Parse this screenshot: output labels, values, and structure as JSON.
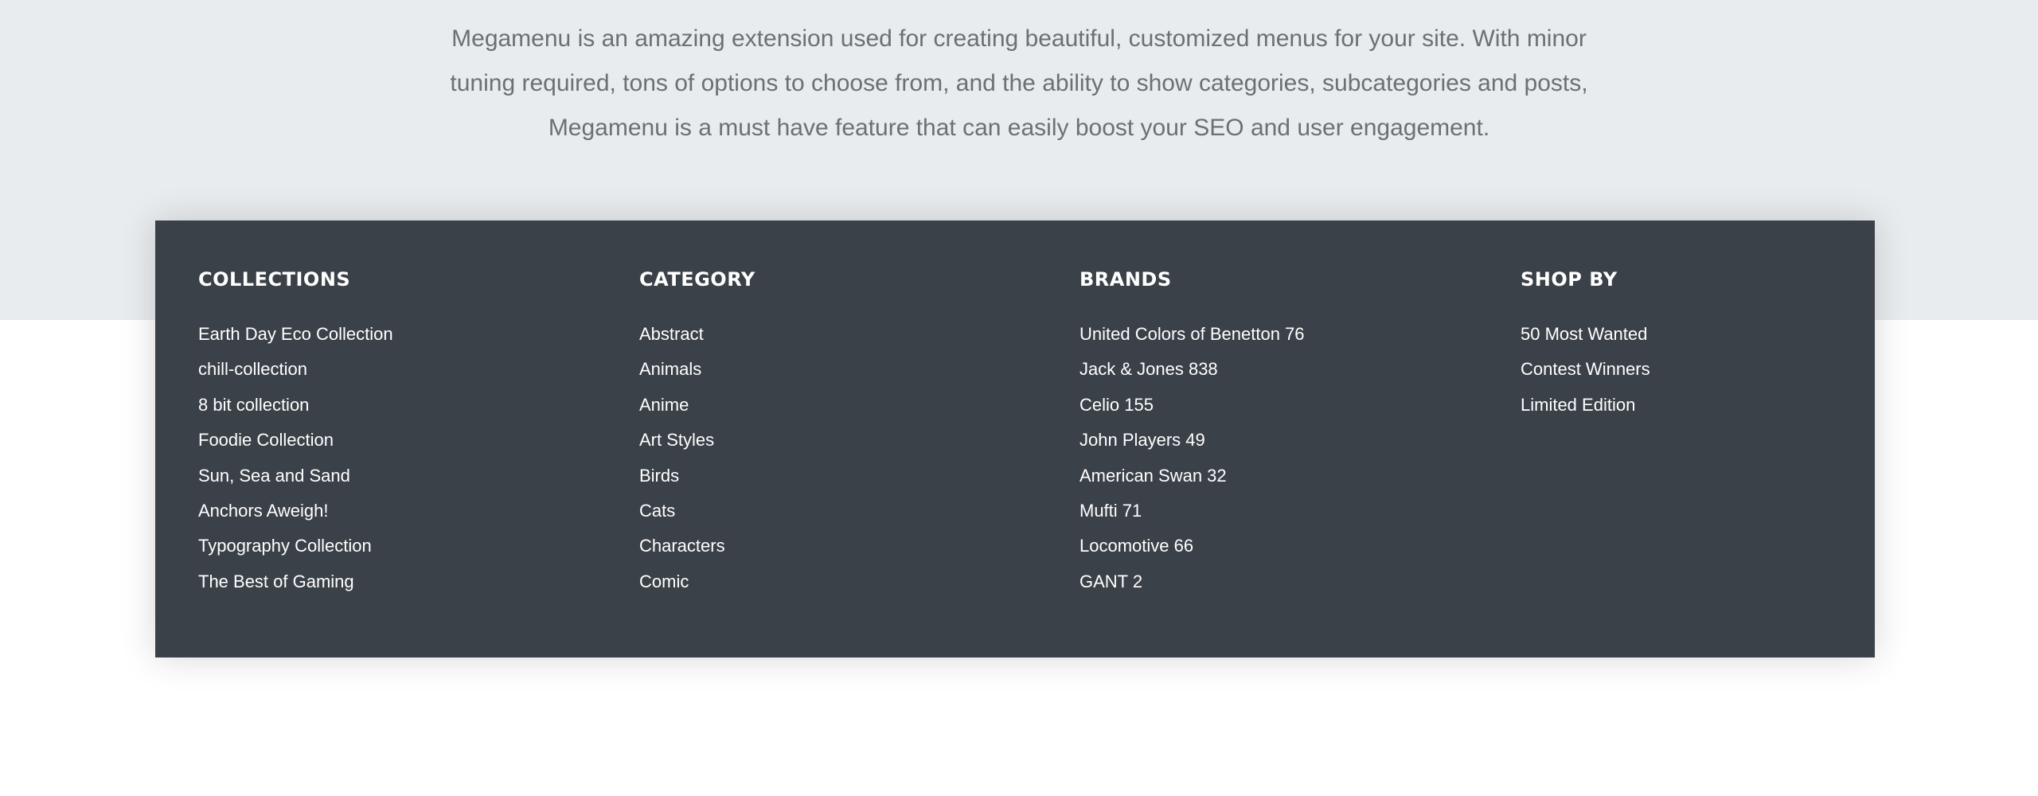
{
  "intro": {
    "lines": [
      "Megamenu is an amazing extension used for creating beautiful, customized menus for your site. With minor",
      "tuning required, tons of options to choose from, and the ability to show categories, subcategories and posts,",
      "Megamenu is a must have feature that can easily boost your SEO and user engagement."
    ]
  },
  "megamenu": {
    "columns": [
      {
        "heading": "COLLECTIONS",
        "items": [
          "Earth Day Eco Collection",
          "chill-collection",
          "8 bit collection",
          "Foodie Collection",
          "Sun, Sea and Sand",
          "Anchors Aweigh!",
          "Typography Collection",
          "The Best of Gaming"
        ]
      },
      {
        "heading": "CATEGORY",
        "items": [
          "Abstract",
          "Animals",
          "Anime",
          "Art Styles",
          "Birds",
          "Cats",
          "Characters",
          "Comic"
        ]
      },
      {
        "heading": "BRANDS",
        "items": [
          "United Colors of Benetton 76",
          "Jack & Jones 838",
          "Celio 155",
          "John Players 49",
          "American Swan 32",
          "Mufti 71",
          "Locomotive 66",
          "GANT 2"
        ]
      },
      {
        "heading": "SHOP BY",
        "items": [
          "50 Most Wanted",
          "Contest Winners",
          "Limited Edition"
        ]
      }
    ]
  },
  "colors": {
    "top_band": "#e9ecef",
    "panel": "#3b4148",
    "intro_text": "#6c6f73",
    "menu_text": "#ffffff",
    "page": "#ffffff"
  }
}
